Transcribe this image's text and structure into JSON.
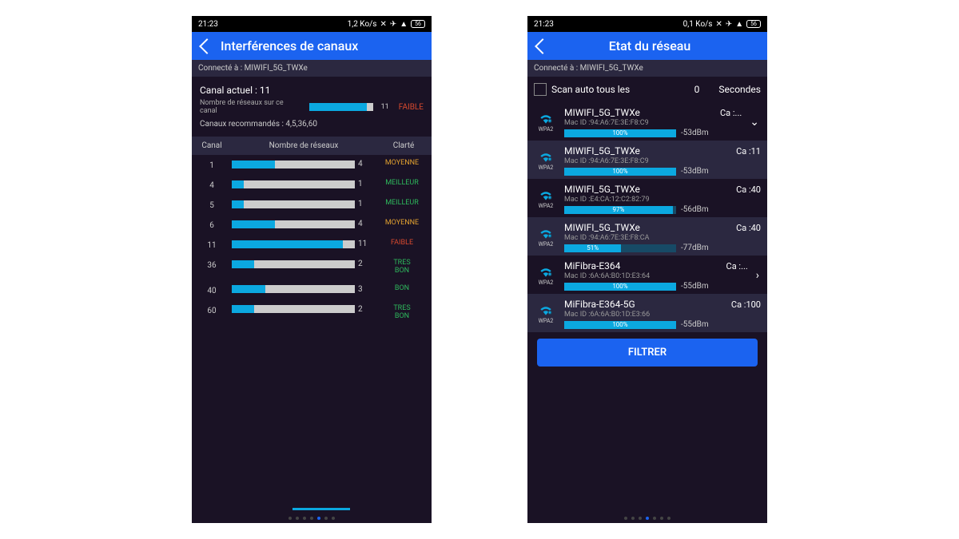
{
  "left": {
    "status": {
      "time": "21:23",
      "rate": "1,2 Ko/s"
    },
    "header": {
      "title": "Interférences de canaux"
    },
    "connected": "Connecté à : MIWIFI_5G_TWXe",
    "summary": {
      "current": "Canal actuel : 11",
      "count_label": "Nombre de réseaux sur ce canal",
      "count_val": "11",
      "count_pct": 90,
      "rating": "FAIBLE",
      "recommended": "Canaux recommandés : 4,5,36,60"
    },
    "table": {
      "h1": "Canal",
      "h2": "Nombre de réseaux",
      "h3": "Clarté",
      "rows": [
        {
          "ch": "1",
          "n": "4",
          "pct": 35,
          "r": "MOYENNE",
          "cls": "moyenne"
        },
        {
          "ch": "4",
          "n": "1",
          "pct": 10,
          "r": "MEILLEUR",
          "cls": "meilleur"
        },
        {
          "ch": "5",
          "n": "1",
          "pct": 10,
          "r": "MEILLEUR",
          "cls": "meilleur"
        },
        {
          "ch": "6",
          "n": "4",
          "pct": 35,
          "r": "MOYENNE",
          "cls": "moyenne"
        },
        {
          "ch": "11",
          "n": "11",
          "pct": 90,
          "r": "FAIBLE",
          "cls": "fa"
        },
        {
          "ch": "36",
          "n": "2",
          "pct": 18,
          "r": "TRES BON",
          "cls": "tresbon"
        },
        {
          "ch": "40",
          "n": "3",
          "pct": 27,
          "r": "BON",
          "cls": "bon"
        },
        {
          "ch": "60",
          "n": "2",
          "pct": 18,
          "r": "TRES BON",
          "cls": "tresbon"
        }
      ]
    }
  },
  "right": {
    "status": {
      "time": "21:23",
      "rate": "0,1 Ko/s"
    },
    "header": {
      "title": "Etat du réseau"
    },
    "connected": "Connecté à : MIWIFI_5G_TWXe",
    "scan": {
      "label": "Scan auto tous les",
      "value": "0",
      "unit": "Secondes"
    },
    "nets": [
      {
        "name": "MIWIFI_5G_TWXe",
        "ca": "Ca :...",
        "mac": "Mac ID :94:A6:7E:3E:F8:C9",
        "pct": "100%",
        "pv": 100,
        "dbm": "-53dBm",
        "sec": "WPA2",
        "alt": false,
        "chev": "down"
      },
      {
        "name": "MIWIFI_5G_TWXe",
        "ca": "Ca :11",
        "mac": "Mac ID :94:A6:7E:3E:F8:C9",
        "pct": "100%",
        "pv": 100,
        "dbm": "-53dBm",
        "sec": "WPA2",
        "alt": true,
        "chev": ""
      },
      {
        "name": "MIWIFI_5G_TWXe",
        "ca": "Ca :40",
        "mac": "Mac ID :E4:CA:12:C2:82:79",
        "pct": "97%",
        "pv": 97,
        "dbm": "-56dBm",
        "sec": "WPA2",
        "alt": false,
        "chev": ""
      },
      {
        "name": "MIWIFI_5G_TWXe",
        "ca": "Ca :40",
        "mac": "Mac ID :94:A6:7E:3E:F8:CA",
        "pct": "51%",
        "pv": 51,
        "dbm": "-77dBm",
        "sec": "WPA2",
        "alt": true,
        "chev": ""
      },
      {
        "name": "MiFibra-E364",
        "ca": "Ca :...",
        "mac": "Mac ID :6A:6A:B0:1D:E3:64",
        "pct": "100%",
        "pv": 100,
        "dbm": "-55dBm",
        "sec": "WPA2",
        "alt": false,
        "chev": "right"
      },
      {
        "name": "MiFibra-E364-5G",
        "ca": "Ca :100",
        "mac": "Mac ID :6A:6A:B0:1D:E3:66",
        "pct": "100%",
        "pv": 100,
        "dbm": "-55dBm",
        "sec": "WPA2",
        "alt": true,
        "chev": ""
      }
    ],
    "filter": "FILTRER"
  }
}
